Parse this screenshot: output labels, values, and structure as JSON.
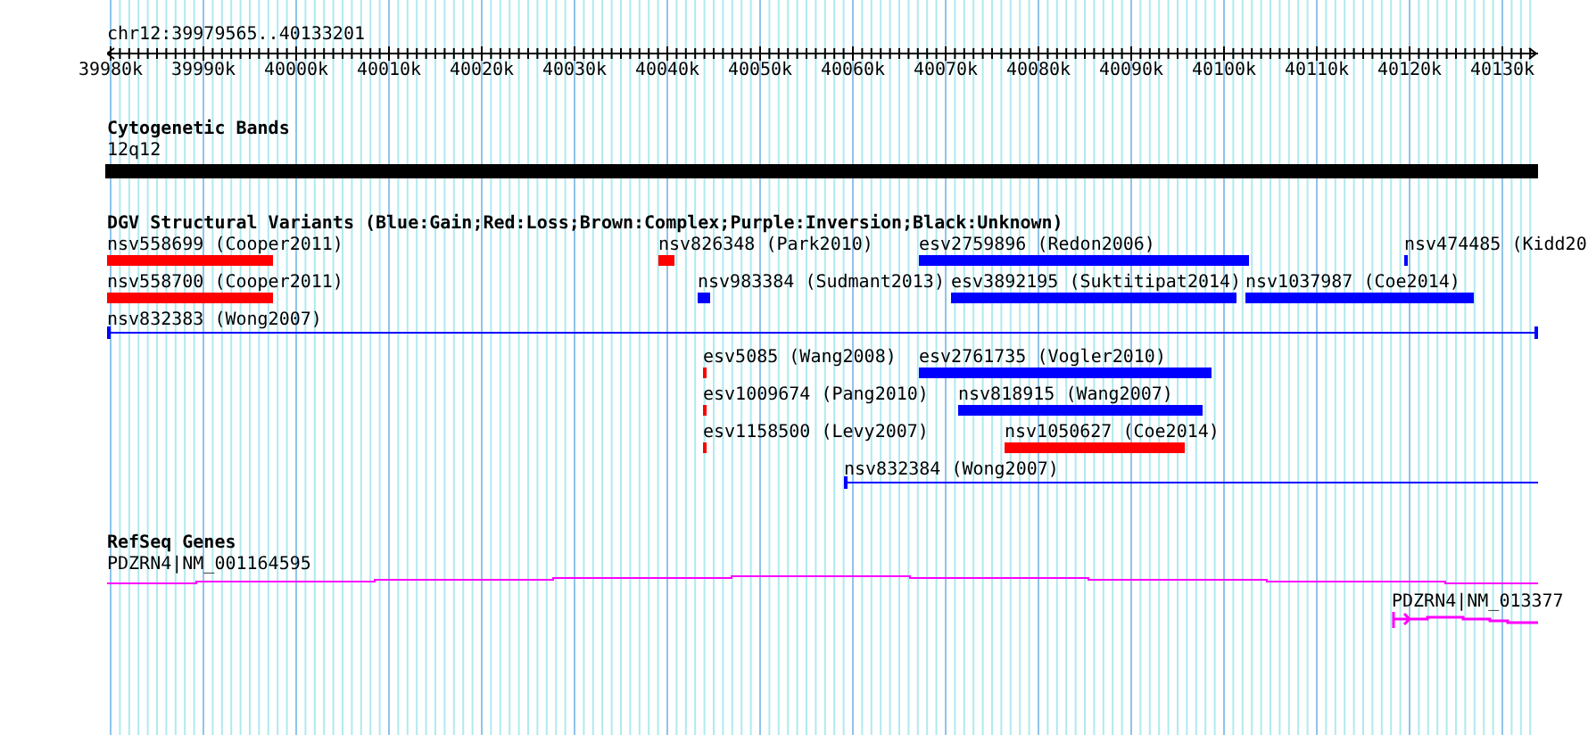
{
  "locus": "chr12:39979565..40133201",
  "ruler": {
    "ticks": [
      "39980k",
      "39990k",
      "40000k",
      "40010k",
      "40020k",
      "40030k",
      "40040k",
      "40050k",
      "40060k",
      "40070k",
      "40080k",
      "40090k",
      "40100k",
      "40110k",
      "40120k",
      "40130k"
    ]
  },
  "cytoband_track": {
    "title": "Cytogenetic Bands",
    "band": "12q12"
  },
  "variant_track": {
    "title": "DGV Structural Variants (Blue:Gain;Red:Loss;Brown:Complex;Purple:Inversion;Black:Unknown)",
    "rows": [
      [
        {
          "label": "nsv558699 (Cooper2011)",
          "color": "#ff0000",
          "kind": "bar"
        },
        {
          "label": "nsv826348 (Park2010)",
          "color": "#ff0000",
          "kind": "bar"
        },
        {
          "label": "esv2759896 (Redon2006)",
          "color": "#0000ff",
          "kind": "bar"
        },
        {
          "label": "nsv474485 (Kidd20",
          "color": "#0000ff",
          "kind": "bar"
        }
      ],
      [
        {
          "label": "nsv558700 (Cooper2011)",
          "color": "#ff0000",
          "kind": "bar"
        },
        {
          "label": "nsv983384 (Sudmant2013)",
          "color": "#0000ff",
          "kind": "bar"
        },
        {
          "label": "esv3892195 (Suktitipat2014)",
          "color": "#0000ff",
          "kind": "bar"
        },
        {
          "label": "nsv1037987 (Coe2014)",
          "color": "#0000ff",
          "kind": "bar"
        }
      ],
      [
        {
          "label": "nsv832383 (Wong2007)",
          "color": "#0000ff",
          "kind": "line"
        }
      ],
      [
        {
          "label": "esv5085 (Wang2008)",
          "color": "#ff0000",
          "kind": "bar"
        },
        {
          "label": "esv2761735 (Vogler2010)",
          "color": "#0000ff",
          "kind": "bar"
        }
      ],
      [
        {
          "label": "esv1009674 (Pang2010)",
          "color": "#ff0000",
          "kind": "bar"
        },
        {
          "label": "nsv818915 (Wang2007)",
          "color": "#0000ff",
          "kind": "bar"
        }
      ],
      [
        {
          "label": "esv1158500 (Levy2007)",
          "color": "#ff0000",
          "kind": "bar"
        },
        {
          "label": "nsv1050627 (Coe2014)",
          "color": "#ff0000",
          "kind": "bar"
        }
      ],
      [
        {
          "label": "nsv832384 (Wong2007)",
          "color": "#0000ff",
          "kind": "line"
        }
      ]
    ]
  },
  "gene_track": {
    "title": "RefSeq Genes",
    "genes": [
      {
        "label": "PDZRN4|NM_001164595"
      },
      {
        "label": "PDZRN4|NM_013377"
      }
    ]
  }
}
